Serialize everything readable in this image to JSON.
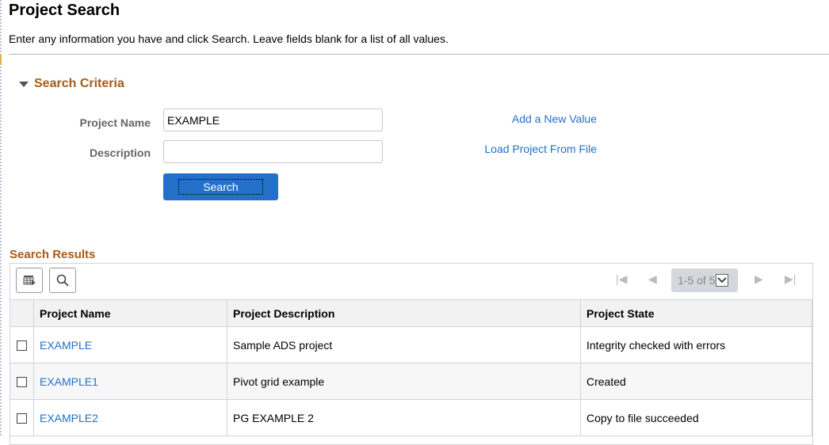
{
  "page": {
    "title": "Project Search",
    "instructions": "Enter any information you have and click Search. Leave fields blank for a list of all values."
  },
  "search_criteria": {
    "section_label": "Search Criteria",
    "fields": [
      {
        "label": "Project Name",
        "value": "EXAMPLE",
        "placeholder": ""
      },
      {
        "label": "Description",
        "value": "",
        "placeholder": ""
      }
    ],
    "search_button": "Search",
    "links": {
      "add_new_value": "Add a New Value",
      "load_project": "Load Project From File"
    }
  },
  "search_results": {
    "title": "Search Results",
    "toolbar": {
      "personalize_icon": "grid-personalize-icon",
      "find_icon": "search-icon"
    },
    "pagination": {
      "range": "1-5 of 5",
      "first_icon": "first-page-icon",
      "prev_icon": "prev-page-icon",
      "next_icon": "next-page-icon",
      "last_icon": "last-page-icon"
    },
    "columns": [
      "Project Name",
      "Project Description",
      "Project State"
    ],
    "rows": [
      {
        "name": "EXAMPLE",
        "description": "Sample ADS project",
        "state": "Integrity checked with errors"
      },
      {
        "name": "EXAMPLE1",
        "description": "Pivot grid example",
        "state": "Created"
      },
      {
        "name": "EXAMPLE2",
        "description": "PG EXAMPLE 2",
        "state": "Copy to file succeeded"
      }
    ]
  },
  "colors": {
    "section_heading": "#a65b1b",
    "link": "#2470c8",
    "primary_button": "#2470c8"
  }
}
